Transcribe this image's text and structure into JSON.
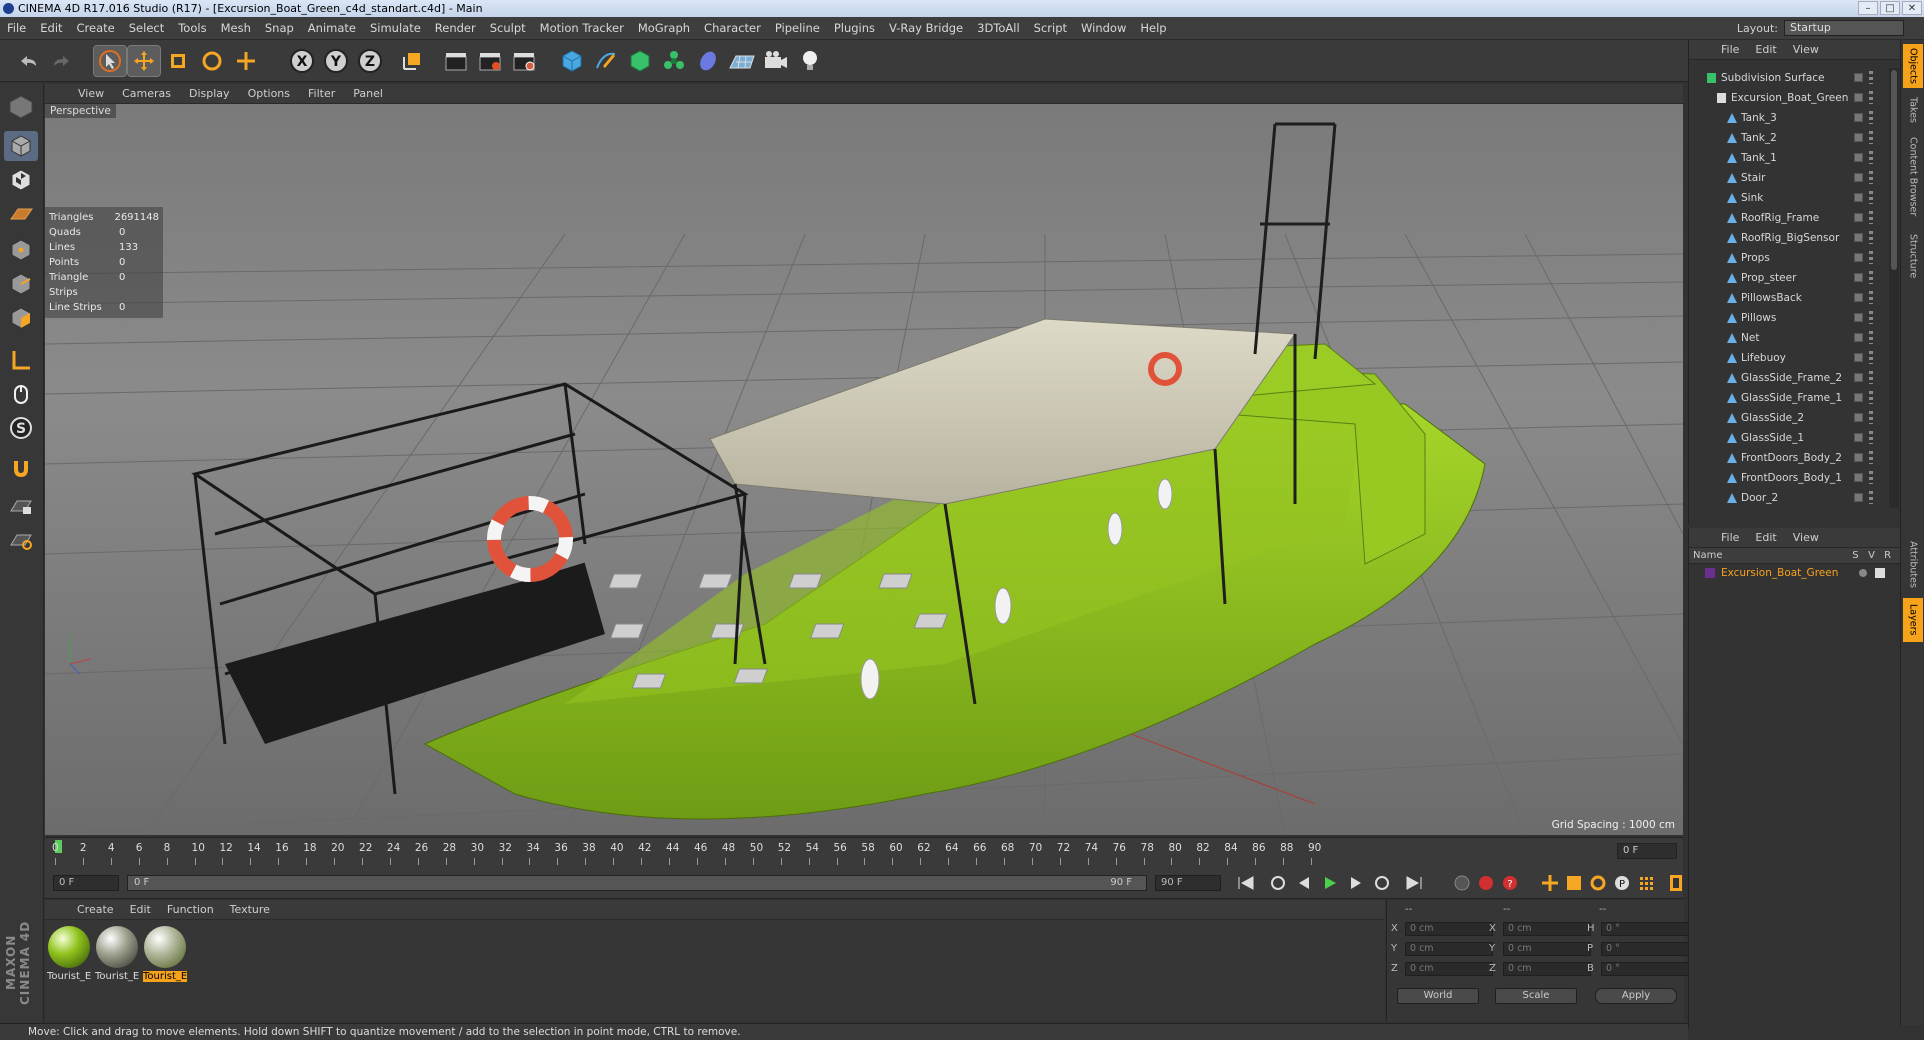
{
  "window": {
    "title": "CINEMA 4D R17.016 Studio (R17) - [Excursion_Boat_Green_c4d_standart.c4d] - Main"
  },
  "menu": [
    "File",
    "Edit",
    "Create",
    "Select",
    "Tools",
    "Mesh",
    "Snap",
    "Animate",
    "Simulate",
    "Render",
    "Sculpt",
    "Motion Tracker",
    "MoGraph",
    "Character",
    "Pipeline",
    "Plugins",
    "V-Ray Bridge",
    "3DToAll",
    "Script",
    "Window",
    "Help"
  ],
  "layout": {
    "label": "Layout:",
    "value": "Startup"
  },
  "viewport": {
    "menu": [
      "View",
      "Cameras",
      "Display",
      "Options",
      "Filter",
      "Panel"
    ],
    "label": "Perspective",
    "stats": [
      {
        "k": "Triangles",
        "v": "2691148"
      },
      {
        "k": "Quads",
        "v": "0"
      },
      {
        "k": "Lines",
        "v": "133"
      },
      {
        "k": "Points",
        "v": "0"
      },
      {
        "k": "Triangle Strips",
        "v": "0"
      },
      {
        "k": "Line Strips",
        "v": "0"
      }
    ],
    "grid_spacing": "Grid Spacing : 1000 cm",
    "colors": {
      "hull": "#8dc21f",
      "canopy": "#cfcab6",
      "bg": "#7f7f7f"
    }
  },
  "timeline": {
    "ticks": [
      "0",
      "2",
      "4",
      "6",
      "8",
      "10",
      "12",
      "14",
      "16",
      "18",
      "20",
      "22",
      "24",
      "26",
      "28",
      "30",
      "32",
      "34",
      "36",
      "38",
      "40",
      "42",
      "44",
      "46",
      "48",
      "50",
      "52",
      "54",
      "56",
      "58",
      "60",
      "62",
      "64",
      "66",
      "68",
      "70",
      "72",
      "74",
      "76",
      "78",
      "80",
      "82",
      "84",
      "86",
      "88",
      "90"
    ],
    "frame": "0 F",
    "start": "0 F",
    "range_start": "0 F",
    "range_end": "90 F",
    "end": "90 F"
  },
  "materials": {
    "menu": [
      "Create",
      "Edit",
      "Function",
      "Texture"
    ],
    "items": [
      "Tourist_E",
      "Tourist_E",
      "Tourist_E"
    ]
  },
  "coords": {
    "header": [
      "--",
      "--",
      "--"
    ],
    "rows": [
      {
        "a": "X",
        "av": "0 cm",
        "b": "X",
        "bv": "0 cm",
        "c": "H",
        "cv": "0 °"
      },
      {
        "a": "Y",
        "av": "0 cm",
        "b": "Y",
        "bv": "0 cm",
        "c": "P",
        "cv": "0 °"
      },
      {
        "a": "Z",
        "av": "0 cm",
        "b": "Z",
        "bv": "0 cm",
        "c": "B",
        "cv": "0 °"
      }
    ],
    "world": "World",
    "scale": "Scale",
    "apply": "Apply"
  },
  "brand": "MAXON CINEMA 4D",
  "status": "Move: Click and drag to move elements. Hold down SHIFT to quantize movement / add to the selection in point mode, CTRL to remove.",
  "objects": {
    "menu": [
      "File",
      "Edit",
      "View"
    ],
    "tree": [
      {
        "name": "Subdivision Surface",
        "level": 0
      },
      {
        "name": "Excursion_Boat_Green",
        "level": 1
      },
      {
        "name": "Tank_3",
        "level": 2
      },
      {
        "name": "Tank_2",
        "level": 2
      },
      {
        "name": "Tank_1",
        "level": 2
      },
      {
        "name": "Stair",
        "level": 2
      },
      {
        "name": "Sink",
        "level": 2
      },
      {
        "name": "RoofRig_Frame",
        "level": 2
      },
      {
        "name": "RoofRig_BigSensor",
        "level": 2
      },
      {
        "name": "Props",
        "level": 2
      },
      {
        "name": "Prop_steer",
        "level": 2
      },
      {
        "name": "PillowsBack",
        "level": 2
      },
      {
        "name": "Pillows",
        "level": 2
      },
      {
        "name": "Net",
        "level": 2
      },
      {
        "name": "Lifebuoy",
        "level": 2
      },
      {
        "name": "GlassSide_Frame_2",
        "level": 2
      },
      {
        "name": "GlassSide_Frame_1",
        "level": 2
      },
      {
        "name": "GlassSide_2",
        "level": 2
      },
      {
        "name": "GlassSide_1",
        "level": 2
      },
      {
        "name": "FrontDoors_Body_2",
        "level": 2
      },
      {
        "name": "FrontDoors_Body_1",
        "level": 2
      },
      {
        "name": "Door_2",
        "level": 2
      }
    ]
  },
  "layers": {
    "menu": [
      "File",
      "Edit",
      "View"
    ],
    "cols": {
      "name": "Name",
      "s": "S",
      "v": "V",
      "r": "R"
    },
    "item": "Excursion_Boat_Green"
  },
  "side_tabs": [
    "Objects",
    "Takes",
    "Content Browser",
    "Structure",
    "Attributes",
    "Layers"
  ]
}
